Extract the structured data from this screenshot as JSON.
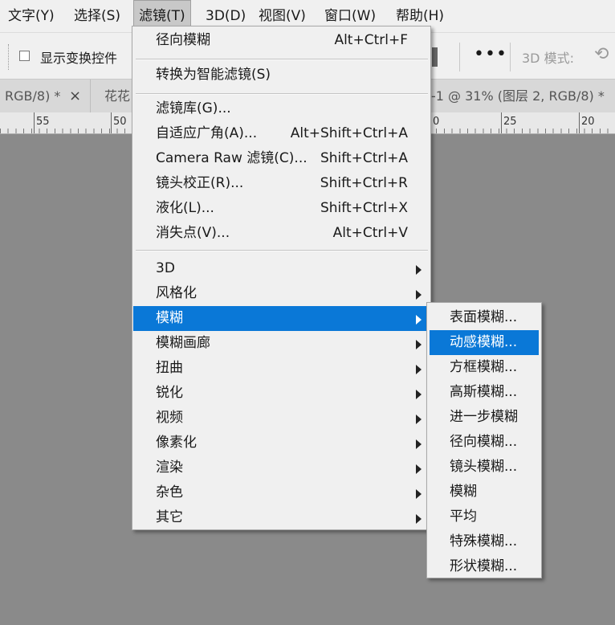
{
  "menubar": {
    "items": [
      "文字(Y)",
      "选择(S)",
      "滤镜(T)",
      "3D(D)",
      "视图(V)",
      "窗口(W)",
      "帮助(H)"
    ],
    "active": "滤镜(T)"
  },
  "options_bar": {
    "show_transform_controls": "显示变换控件",
    "show_transform_checked": false,
    "more_icon": "ellipsis-icon",
    "mode_label": "3D 模式:",
    "mode_icon": "orbit-3d-icon"
  },
  "tabs": {
    "tab1": "RGB/8) *",
    "tab1_close": "×",
    "tab2": "花花",
    "tab3": "-1 @ 31% (图层 2, RGB/8) *"
  },
  "ruler": {
    "labels": [
      "55",
      "50",
      "0",
      "25",
      "20"
    ]
  },
  "filter_menu": {
    "group1": [
      {
        "label": "径向模糊",
        "shortcut": "Alt+Ctrl+F"
      }
    ],
    "group2": [
      {
        "label": "转换为智能滤镜(S)",
        "shortcut": ""
      }
    ],
    "group3": [
      {
        "label": "滤镜库(G)...",
        "shortcut": ""
      },
      {
        "label": "自适应广角(A)...",
        "shortcut": "Alt+Shift+Ctrl+A"
      },
      {
        "label": "Camera Raw 滤镜(C)...",
        "shortcut": "Shift+Ctrl+A"
      },
      {
        "label": "镜头校正(R)...",
        "shortcut": "Shift+Ctrl+R"
      },
      {
        "label": "液化(L)...",
        "shortcut": "Shift+Ctrl+X"
      },
      {
        "label": "消失点(V)...",
        "shortcut": "Alt+Ctrl+V"
      }
    ],
    "group4": [
      {
        "label": "3D"
      },
      {
        "label": "风格化"
      },
      {
        "label": "模糊",
        "highlighted": true
      },
      {
        "label": "模糊画廊"
      },
      {
        "label": "扭曲"
      },
      {
        "label": "锐化"
      },
      {
        "label": "视频"
      },
      {
        "label": "像素化"
      },
      {
        "label": "渲染"
      },
      {
        "label": "杂色"
      },
      {
        "label": "其它"
      }
    ]
  },
  "blur_submenu": {
    "items": [
      {
        "label": "表面模糊..."
      },
      {
        "label": "动感模糊...",
        "highlighted": true
      },
      {
        "label": "方框模糊..."
      },
      {
        "label": "高斯模糊..."
      },
      {
        "label": "进一步模糊"
      },
      {
        "label": "径向模糊..."
      },
      {
        "label": "镜头模糊..."
      },
      {
        "label": "模糊"
      },
      {
        "label": "平均"
      },
      {
        "label": "特殊模糊..."
      },
      {
        "label": "形状模糊..."
      }
    ]
  },
  "colors": {
    "highlight": "#0a78d7",
    "canvas": "#8a8a8a",
    "menu_bg": "#f0f0f0"
  }
}
